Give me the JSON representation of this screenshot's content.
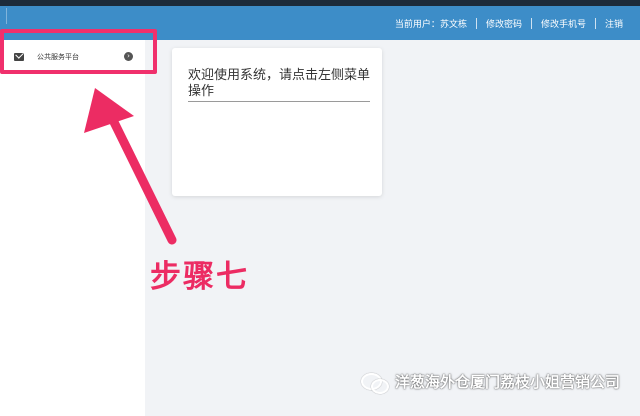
{
  "header": {
    "current_user_prefix": "当前用户：",
    "current_user_name": "苏文栋",
    "change_password": "修改密码",
    "change_phone": "修改手机号",
    "logout": "注销"
  },
  "sidebar": {
    "items": [
      {
        "label": "公共服务平台",
        "icon": "envelope-icon"
      }
    ]
  },
  "main": {
    "welcome_text": "欢迎使用系统，请点击左侧菜单操作"
  },
  "annotation": {
    "step_label": "步骤七"
  },
  "watermark": {
    "text": "洋葱海外仓厦门荔枝小姐营销公司"
  },
  "colors": {
    "header": "#3d8dc8",
    "highlight": "#f0306c"
  }
}
